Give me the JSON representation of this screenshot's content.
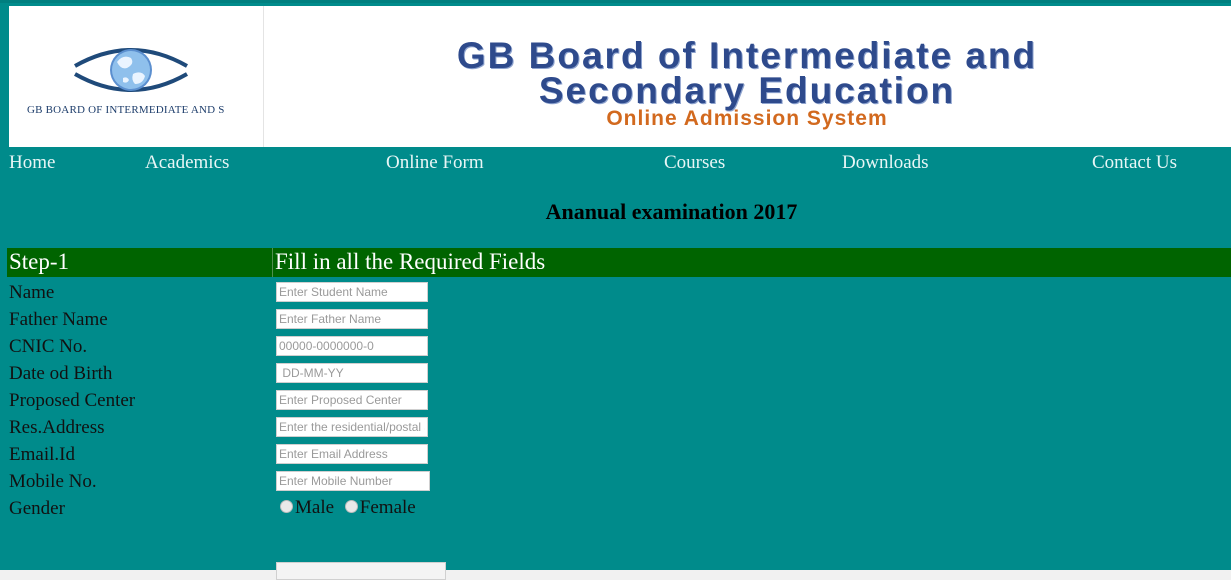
{
  "header": {
    "logo_caption": "GB BOARD OF INTERMEDIATE AND S",
    "banner_line1": "GB Board of Intermediate and",
    "banner_line2": "Secondary Education",
    "banner_line3": "Online Admission System"
  },
  "nav": {
    "items": [
      {
        "label": "Home"
      },
      {
        "label": "Academics"
      },
      {
        "label": "Online Form"
      },
      {
        "label": "Courses"
      },
      {
        "label": "Downloads"
      },
      {
        "label": "Contact Us"
      }
    ]
  },
  "exam_title": "Ananual examination 2017",
  "step": {
    "label": "Step-1",
    "description": "Fill in all the Required Fields"
  },
  "form": {
    "fields": [
      {
        "label": "Name",
        "placeholder": "Enter Student Name",
        "value": ""
      },
      {
        "label": "Father Name",
        "placeholder": "Enter Father Name",
        "value": ""
      },
      {
        "label": "CNIC No.",
        "placeholder": "00000-0000000-0",
        "value": ""
      },
      {
        "label": "Date od Birth",
        "placeholder": " DD-MM-YY",
        "value": ""
      },
      {
        "label": "Proposed Center",
        "placeholder": "Enter Proposed Center",
        "value": ""
      },
      {
        "label": "Res.Address",
        "placeholder": "Enter the residential/postal address",
        "value": ""
      },
      {
        "label": "Email.Id",
        "placeholder": "Enter Email Address",
        "value": ""
      },
      {
        "label": "Mobile No.",
        "placeholder": "Enter Mobile Number",
        "value": ""
      }
    ],
    "gender": {
      "label": "Gender",
      "options": [
        "Male",
        "Female"
      ]
    }
  },
  "colors": {
    "page_background": "#008b8b",
    "step_bar": "#006400",
    "banner_blue": "#2e4a8c",
    "banner_orange": "#d2691e"
  }
}
